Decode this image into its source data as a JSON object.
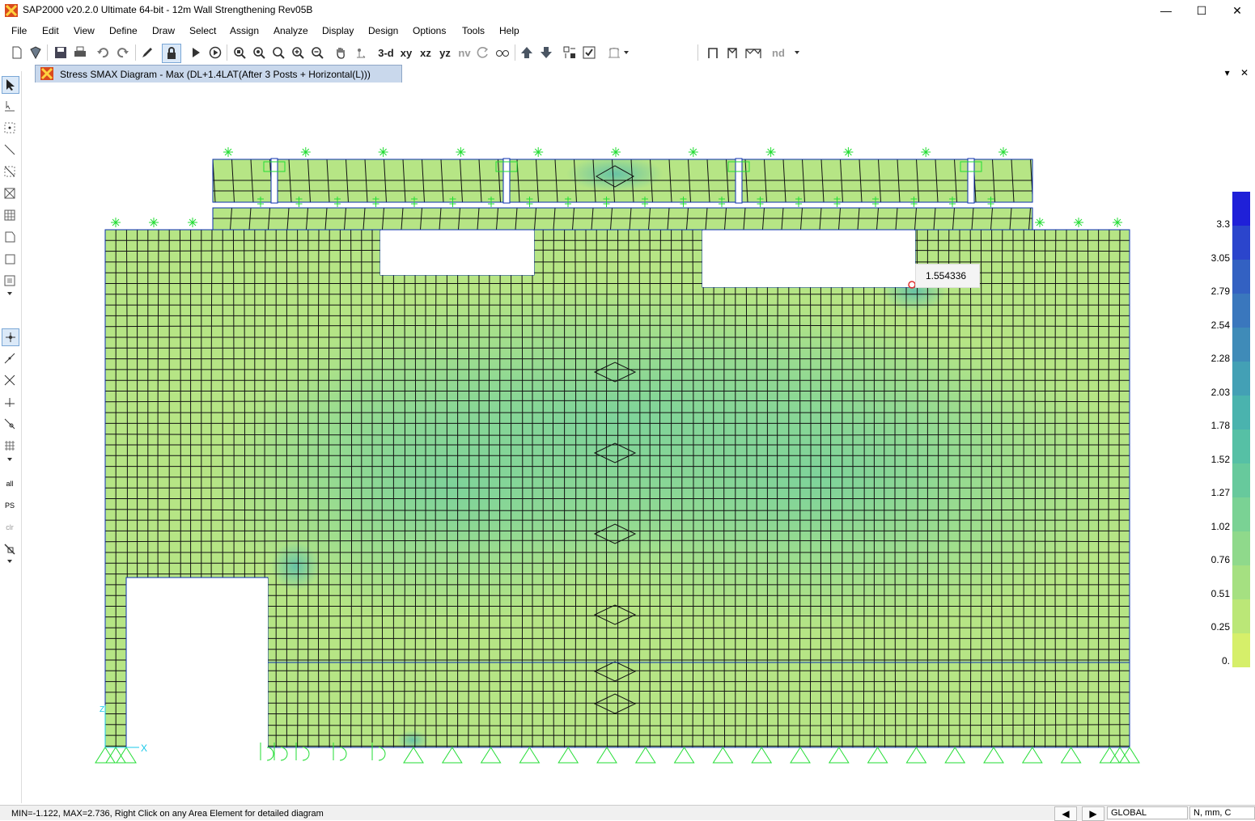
{
  "window": {
    "title": "SAP2000 v20.2.0 Ultimate 64-bit - 12m Wall Strengthening Rev05B",
    "minimize": "—",
    "maximize": "☐",
    "close": "✕"
  },
  "menu": [
    "File",
    "Edit",
    "View",
    "Define",
    "Draw",
    "Select",
    "Assign",
    "Analyze",
    "Display",
    "Design",
    "Options",
    "Tools",
    "Help"
  ],
  "toolbar": {
    "view_3d": "3-d",
    "view_xy": "xy",
    "view_xz": "xz",
    "view_yz": "yz",
    "view_nv": "nv",
    "nd_label": "nd"
  },
  "document_tab": {
    "title": "Stress SMAX Diagram - Max   (DL+1.4LAT(After 3 Posts + Horizontal(L)))",
    "dropdown": "▾",
    "close": "✕"
  },
  "left_toolbar_labels": {
    "all": "all",
    "ps": "PS",
    "clr": "clr"
  },
  "legend": {
    "values": [
      "3.3",
      "3.05",
      "2.79",
      "2.54",
      "2.28",
      "2.03",
      "1.78",
      "1.52",
      "1.27",
      "1.02",
      "0.76",
      "0.51",
      "0.25",
      "0."
    ],
    "colors": [
      "#1f20d8",
      "#2b45cc",
      "#3361c2",
      "#3a77bd",
      "#3f8bb8",
      "#43a0b5",
      "#4ab3ae",
      "#56c0a5",
      "#67c99c",
      "#7ad294",
      "#8fd98b",
      "#a5e081",
      "#bbe777",
      "#d6ef6a"
    ]
  },
  "tooltip_value": "1.554336",
  "axis": {
    "x": "X",
    "z": "Z"
  },
  "status": {
    "message": "MIN=-1.122, MAX=2.736, Right Click on any Area Element for detailed diagram",
    "coord_system": "GLOBAL",
    "units": "N, mm, C",
    "prev": "◀",
    "next": "▶"
  }
}
